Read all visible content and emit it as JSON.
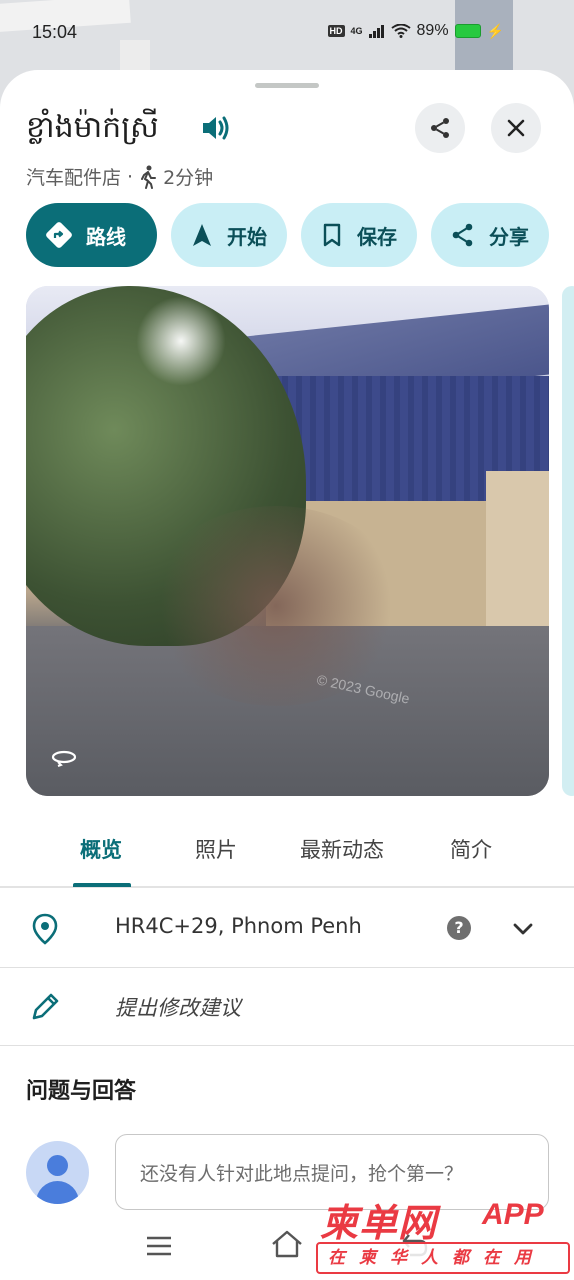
{
  "status_bar": {
    "time": "15:04",
    "hd": "HD",
    "network": "4G",
    "battery": "89%"
  },
  "place": {
    "title": "ខ្លាំងម៉ាក់ស្រី",
    "category": "汽车配件店",
    "separator": "·",
    "walk_time": "2分钟"
  },
  "actions": [
    {
      "label": "路线",
      "icon": "directions-icon"
    },
    {
      "label": "开始",
      "icon": "navigation-icon"
    },
    {
      "label": "保存",
      "icon": "bookmark-icon"
    },
    {
      "label": "分享",
      "icon": "share-icon"
    }
  ],
  "photo": {
    "copyright": "© 2023 Google"
  },
  "tabs": [
    {
      "label": "概览",
      "active": true
    },
    {
      "label": "照片",
      "active": false
    },
    {
      "label": "最新动态",
      "active": false
    },
    {
      "label": "简介",
      "active": false
    }
  ],
  "address_row": {
    "text": "HR4C+29, Phnom Penh",
    "help": "?"
  },
  "edit_row": {
    "text": "提出修改建议"
  },
  "qa": {
    "title": "问题与回答",
    "placeholder": "还没有人针对此地点提问，抢个第一？"
  },
  "watermark": {
    "main": "柬单网",
    "app": "APP",
    "sub": "在柬华人都在用"
  },
  "colors": {
    "accent": "#0b6e78",
    "chip_bg": "#c9eef5",
    "watermark": "#ea3a43"
  }
}
